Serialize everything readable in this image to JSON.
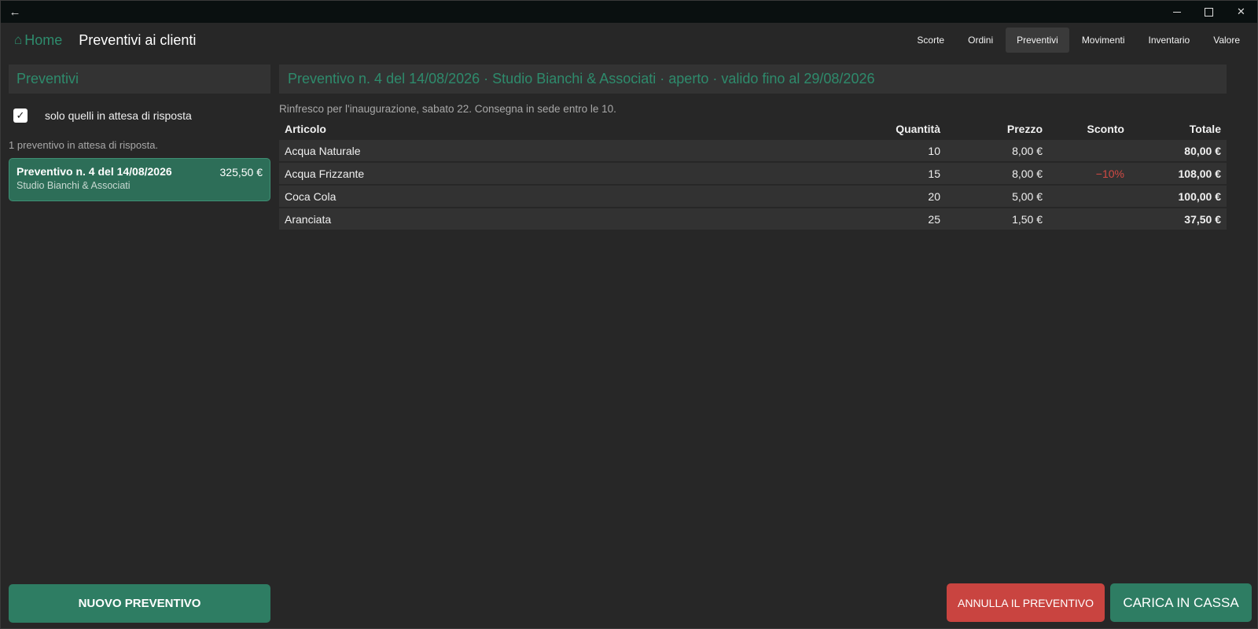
{
  "titlebar": {
    "back_icon": "←"
  },
  "header": {
    "home_icon": "⌂",
    "home_label": "Home",
    "title": "Preventivi ai clienti",
    "tabs": [
      {
        "label": "Scorte"
      },
      {
        "label": "Ordini"
      },
      {
        "label": "Preventivi"
      },
      {
        "label": "Movimenti"
      },
      {
        "label": "Inventario"
      },
      {
        "label": "Valore"
      }
    ],
    "active_tab": "Preventivi"
  },
  "left": {
    "header": "Preventivi",
    "filter_checked": true,
    "filter_check_glyph": "✓",
    "filter_label": "solo quelli in attesa di risposta",
    "count_text": "1 preventivo in attesa di risposta.",
    "quotes": [
      {
        "title": "Preventivo n. 4 del 14/08/2026",
        "amount": "325,50 €",
        "client": "Studio Bianchi & Associati"
      }
    ],
    "new_button": "NUOVO PREVENTIVO"
  },
  "right": {
    "header": "Preventivo n. 4 del 14/08/2026 · Studio Bianchi & Associati · aperto · valido fino al 29/08/2026",
    "notes": "Rinfresco per l'inaugurazione, sabato 22. Consegna in sede entro le 10.",
    "columns": {
      "article": "Articolo",
      "quantity": "Quantità",
      "price": "Prezzo",
      "discount": "Sconto",
      "total": "Totale"
    },
    "rows": [
      {
        "article": "Acqua Naturale",
        "quantity": "10",
        "price": "8,00 €",
        "discount": "",
        "total": "80,00 €"
      },
      {
        "article": "Acqua Frizzante",
        "quantity": "15",
        "price": "8,00 €",
        "discount": "−10%",
        "total": "108,00 €"
      },
      {
        "article": "Coca Cola",
        "quantity": "20",
        "price": "5,00 €",
        "discount": "",
        "total": "100,00 €"
      },
      {
        "article": "Aranciata",
        "quantity": "25",
        "price": "1,50 €",
        "discount": "",
        "total": "37,50 €"
      }
    ],
    "cancel_button": "ANNULLA IL PREVENTIVO",
    "load_button": "CARICA IN CASSA"
  },
  "colors": {
    "accent": "#2e8b6c",
    "button_green": "#2e7d63",
    "button_red": "#c94440",
    "discount_red": "#d24a44",
    "background": "#272727"
  }
}
